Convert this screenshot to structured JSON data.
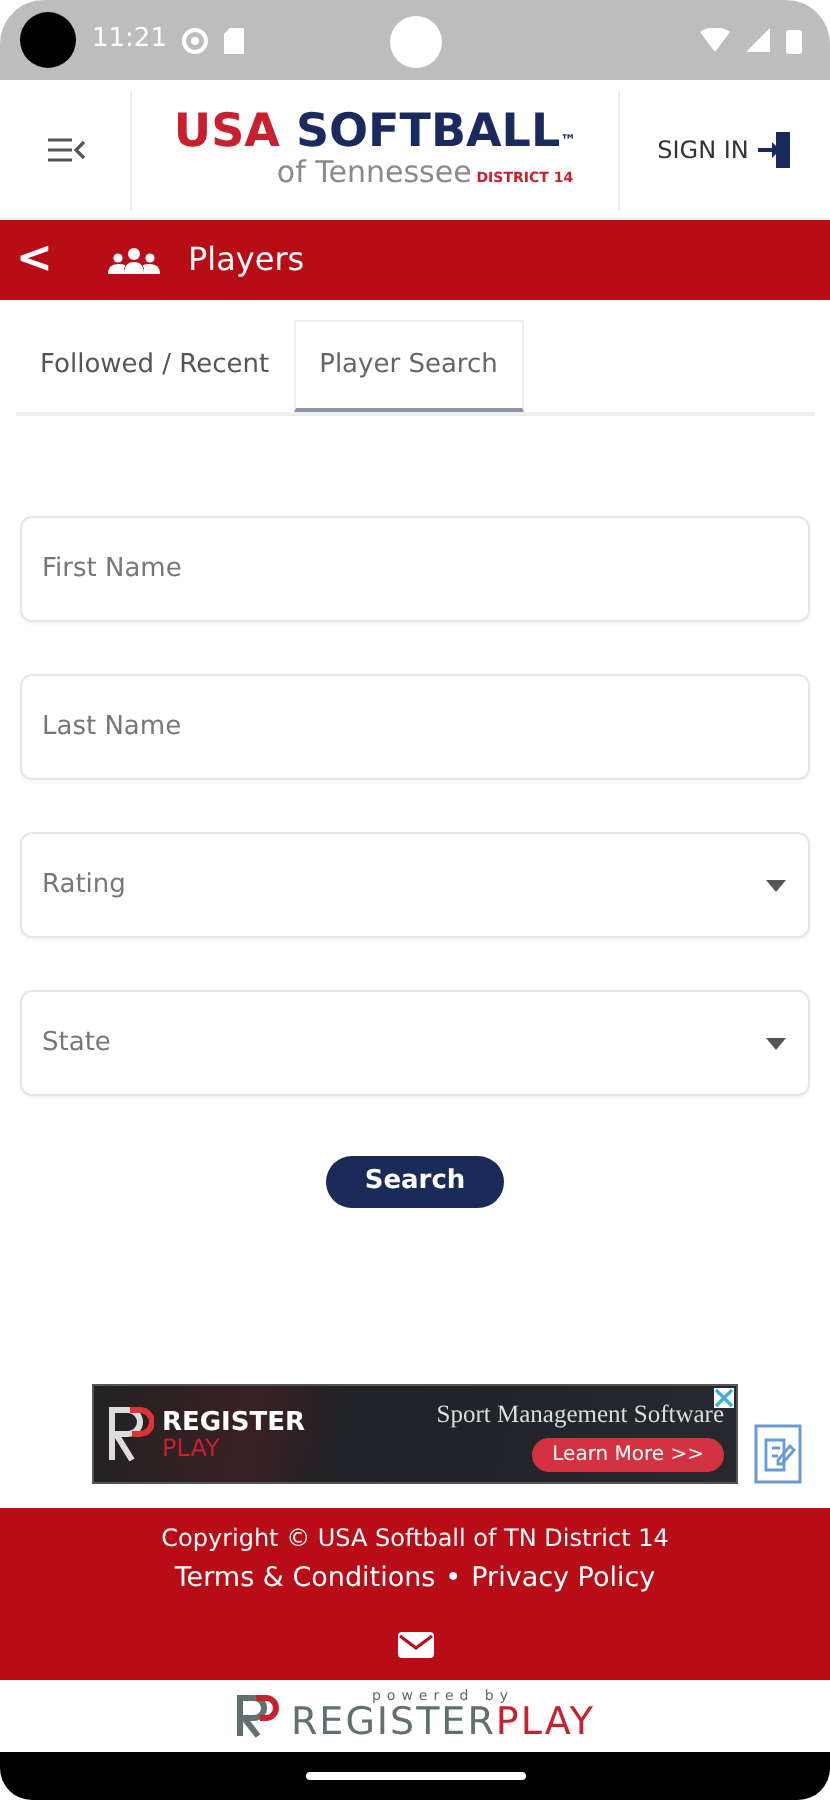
{
  "status_bar": {
    "time": "11:21"
  },
  "header": {
    "logo": {
      "main_left": "USA",
      "main_right": "SOFTBALL",
      "trademark": "™",
      "sub": "of Tennessee",
      "district": "DISTRICT 14"
    },
    "sign_in": "SIGN IN"
  },
  "title_bar": {
    "back": "<",
    "title": "Players"
  },
  "tabs": [
    {
      "label": "Followed / Recent",
      "selected": false
    },
    {
      "label": "Player Search",
      "selected": true
    }
  ],
  "fields": [
    {
      "kind": "input",
      "placeholder": "First Name"
    },
    {
      "kind": "input",
      "placeholder": "Last Name"
    },
    {
      "kind": "select",
      "placeholder": "Rating"
    },
    {
      "kind": "select",
      "placeholder": "State"
    }
  ],
  "search_button": "Search",
  "ad": {
    "brand_top": "REGISTER",
    "brand_bottom": "PLAY",
    "headline": "Sport Management Software",
    "cta": "Learn More >>"
  },
  "footer": {
    "copyright": "Copyright © USA Softball of TN District 14",
    "links": [
      "Terms & Conditions",
      "Privacy Policy"
    ],
    "separator": "•"
  },
  "powered": {
    "label": "powered by",
    "brand_main": "REGISTER",
    "brand_accent": "PLAY"
  }
}
